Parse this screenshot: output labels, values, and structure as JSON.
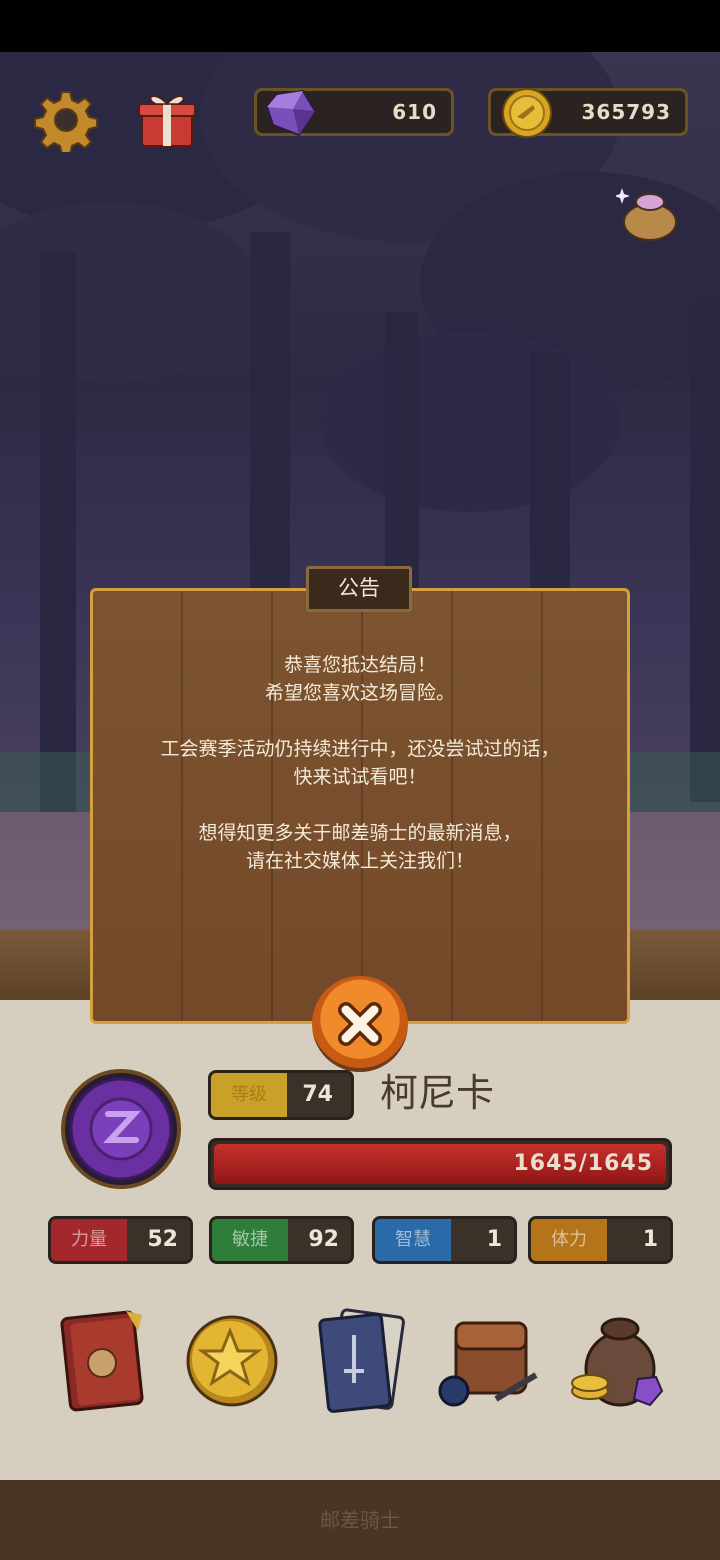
{
  "currency": {
    "gems": "610",
    "coins": "365793"
  },
  "announcement": {
    "title": "公告",
    "lines": [
      "恭喜您抵达结局！",
      "希望您喜欢这场冒险。",
      "工会赛季活动仍持续进行中，还没尝试过的话，",
      "快来试试看吧！",
      "想得知更多关于邮差骑士的最新消息，",
      "请在社交媒体上关注我们！"
    ]
  },
  "character": {
    "level_label": "等级",
    "level": "74",
    "name": "柯尼卡",
    "hp": "1645/1645",
    "hp_fraction": 1.0
  },
  "stats": [
    {
      "label": "力量",
      "value": "52",
      "color": "#a3282b"
    },
    {
      "label": "敏捷",
      "value": "92",
      "color": "#2f7d3a"
    },
    {
      "label": "智慧",
      "value": "1",
      "color": "#2a6aa8"
    },
    {
      "label": "体力",
      "value": "1",
      "color": "#b5741a"
    }
  ],
  "menu_icons": [
    "journal-book-icon",
    "star-coin-icon",
    "card-deck-icon",
    "backpack-icon",
    "treasure-bag-icon"
  ],
  "footer": {
    "label": "邮差骑士"
  },
  "colors": {
    "dialog_border": "#d6a03c",
    "hp_bar": "#b21e1e",
    "panel": "#d6cfc0"
  }
}
